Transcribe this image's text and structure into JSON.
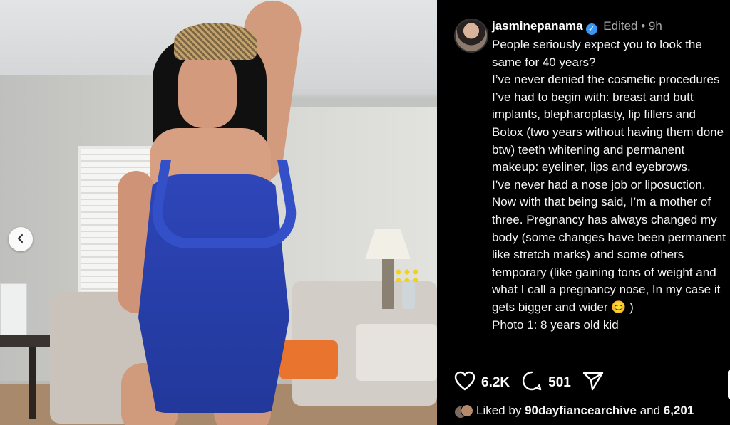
{
  "post": {
    "username": "jasminepanama",
    "verified_mark": "✓",
    "edited_label": "Edited",
    "separator": "•",
    "time": "9h",
    "caption": "People seriously expect you to look the same for 40 years?\nI’ve never denied the cosmetic procedures I’ve had to begin with: breast and butt implants, blepharoplasty, lip fillers and Botox (two years without having them done btw) teeth whitening and permanent makeup: eyeliner, lips and eyebrows.\nI’ve never had a nose job or liposuction.\nNow with that being said, I’m a mother of three. Pregnancy has always changed my body (some changes have been permanent like stretch marks) and some others temporary (like gaining tons of weight and what I call a pregnancy nose, In my case it gets bigger and wider 😊 )\nPhoto 1: 8 years old kid"
  },
  "actions": {
    "likes": "6.2K",
    "comments": "501",
    "like_icon": "heart-icon",
    "comment_icon": "comment-bubble-icon",
    "share_icon": "paper-plane-icon"
  },
  "liked_by": {
    "prefix": "Liked by",
    "user": "90dayfiancearchive",
    "connector": "and",
    "count": "6,201"
  },
  "carousel": {
    "prev_icon": "chevron-left-icon",
    "prev_glyph": "‹"
  },
  "colors": {
    "background": "#000000",
    "verified": "#3897f0",
    "meta_text": "#a8a8a8"
  }
}
